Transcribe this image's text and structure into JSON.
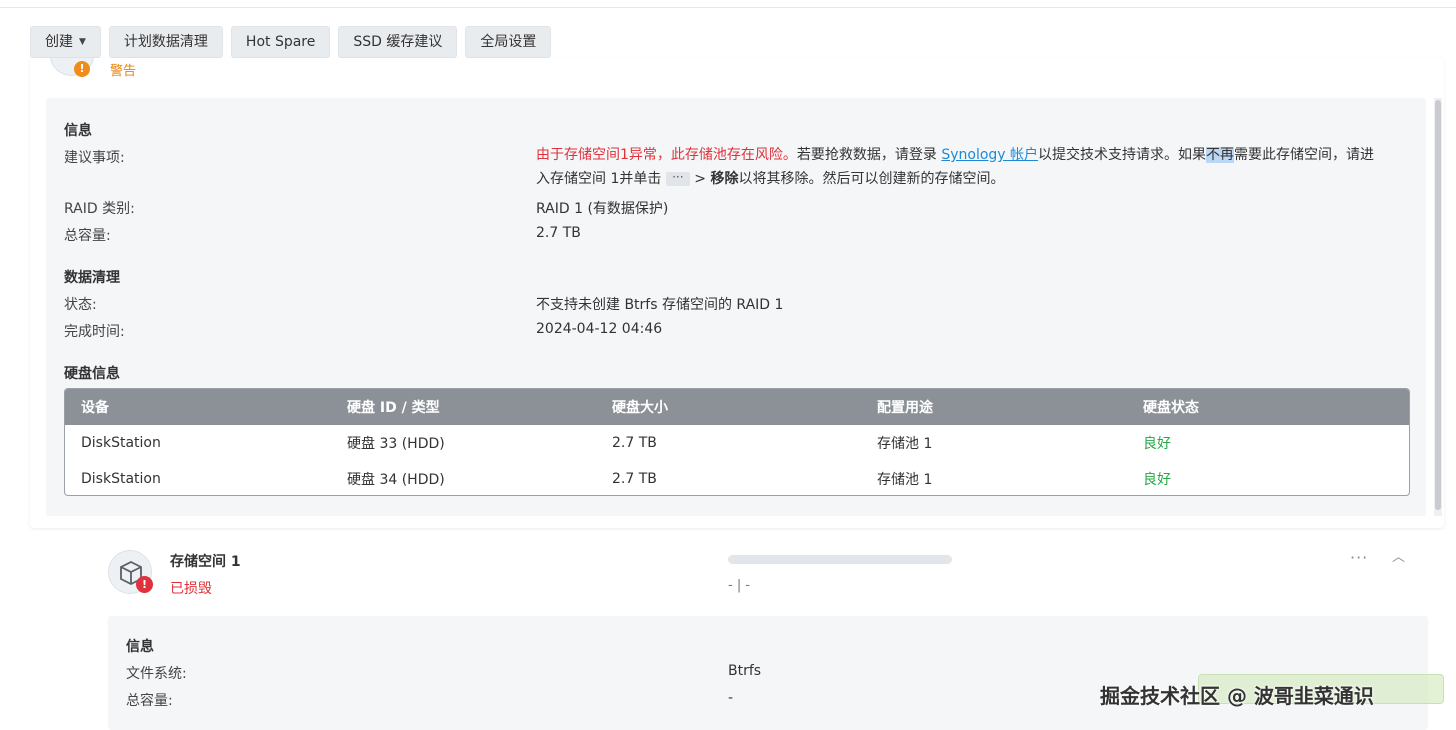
{
  "toolbar": {
    "create_label": "创建",
    "scrub_label": "计划数据清理",
    "hotspare_label": "Hot Spare",
    "ssd_label": "SSD 缓存建议",
    "global_label": "全局设置"
  },
  "pool": {
    "status_text": "警告",
    "info_title": "信息",
    "advice_label": "建议事项:",
    "advice_red": "由于存储空间1异常，此存储池存在风险。",
    "advice_part1": "若要抢救数据，请登录 ",
    "advice_link": "Synology 帐户",
    "advice_part2": "以提交技术支持请求。如果",
    "advice_highlight": "不再",
    "advice_part3": "需要此存储空间，请进",
    "advice_line2a": "入存储空间 1并单击 ",
    "advice_more": "···",
    "advice_line2b": " > ",
    "advice_remove": "移除",
    "advice_line2c": "以将其移除。然后可以创建新的存储空间。",
    "raid_label": "RAID 类别:",
    "raid_value": "RAID 1 (有数据保护)",
    "capacity_label": "总容量:",
    "capacity_value": "2.7 TB",
    "scrub_title": "数据清理",
    "scrub_status_label": "状态:",
    "scrub_status_value": "不支持未创建 Btrfs 存储空间的 RAID 1",
    "scrub_time_label": "完成时间:",
    "scrub_time_value": "2024-04-12 04:46",
    "disk_title": "硬盘信息"
  },
  "disk_table": {
    "headers": [
      "设备",
      "硬盘 ID / 类型",
      "硬盘大小",
      "配置用途",
      "硬盘状态"
    ],
    "rows": [
      [
        "DiskStation",
        "硬盘 33 (HDD)",
        "2.7 TB",
        "存储池 1",
        "良好"
      ],
      [
        "DiskStation",
        "硬盘 34 (HDD)",
        "2.7 TB",
        "存储池 1",
        "良好"
      ]
    ]
  },
  "volume": {
    "name": "存储空间 1",
    "status": "已损毁",
    "usage_text": "- | -",
    "more_glyph": "···",
    "collapse_glyph": "︿",
    "info_title": "信息",
    "fs_label": "文件系统:",
    "fs_value": "Btrfs",
    "capacity_label": "总容量:",
    "capacity_value": "-"
  },
  "watermark": "掘金技术社区 @ 波哥韭菜通识",
  "colors": {
    "warning": "#e8820c",
    "danger": "#e0323c",
    "good": "#28a745",
    "link": "#1e8ad6",
    "table_header": "#8c9197"
  }
}
